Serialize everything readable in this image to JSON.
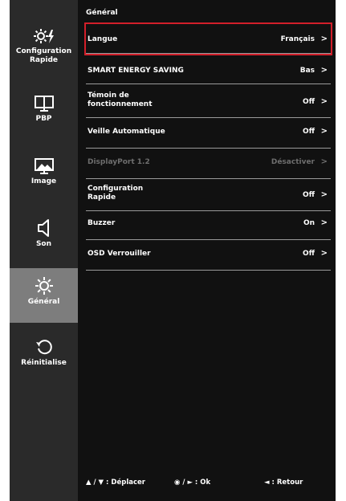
{
  "sidebar": {
    "items": [
      {
        "label": "Configuration Rapide",
        "icon": "quick-settings-icon"
      },
      {
        "label": "PBP",
        "icon": "pbp-icon"
      },
      {
        "label": "Image",
        "icon": "image-icon"
      },
      {
        "label": "Son",
        "icon": "speaker-icon"
      },
      {
        "label": "Général",
        "icon": "gear-icon",
        "active": true
      },
      {
        "label": "Réinitialise",
        "icon": "reset-icon"
      }
    ]
  },
  "main": {
    "title": "Général",
    "rows": [
      {
        "label": "Langue",
        "value": "Français",
        "selected": true
      },
      {
        "label": "SMART ENERGY SAVING",
        "value": "Bas"
      },
      {
        "label": "Témoin de fonctionnement",
        "value": "Off"
      },
      {
        "label": "Veille Automatique",
        "value": "Off"
      },
      {
        "label": "DisplayPort 1.2",
        "value": "Désactiver",
        "disabled": true
      },
      {
        "label": "Configuration Rapide",
        "value": "Off"
      },
      {
        "label": "Buzzer",
        "value": "On"
      },
      {
        "label": "OSD Verrouiller",
        "value": "Off"
      }
    ],
    "chevron": ">"
  },
  "footer": {
    "move": "▲ / ▼ : Déplacer",
    "ok": "◉ / ► : Ok",
    "back": "◄ : Retour"
  }
}
